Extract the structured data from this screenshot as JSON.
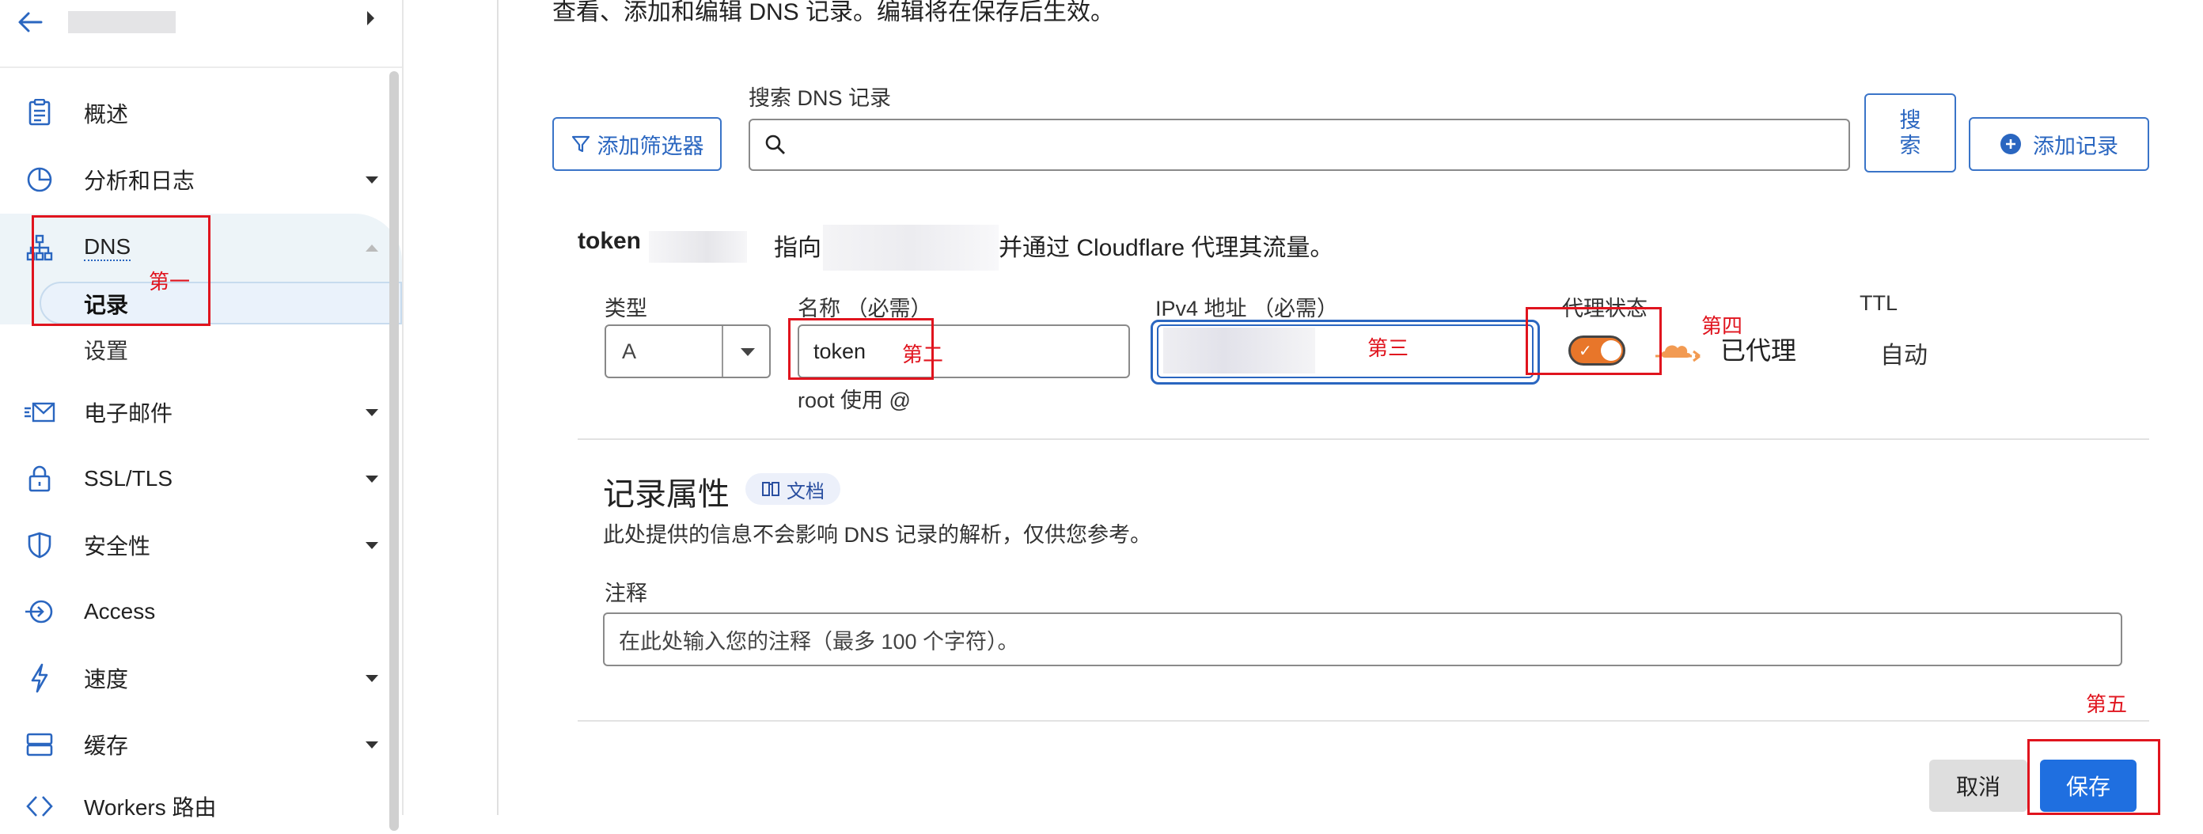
{
  "sidebar": {
    "back_icon": "arrow-left-icon",
    "account_caret_icon": "caret-right-icon",
    "items": [
      {
        "label": "概述",
        "icon": "document-icon"
      },
      {
        "label": "分析和日志",
        "icon": "pie-chart-icon"
      },
      {
        "label": "DNS",
        "icon": "network-icon"
      },
      {
        "label": "电子邮件",
        "icon": "mail-icon"
      },
      {
        "label": "SSL/TLS",
        "icon": "lock-icon"
      },
      {
        "label": "安全性",
        "icon": "shield-icon"
      },
      {
        "label": "Access",
        "icon": "access-icon"
      },
      {
        "label": "速度",
        "icon": "bolt-icon"
      },
      {
        "label": "缓存",
        "icon": "storage-icon"
      },
      {
        "label": "Workers 路由",
        "icon": "code-icon"
      }
    ],
    "dns_sub": [
      {
        "label": "记录"
      },
      {
        "label": "设置"
      }
    ]
  },
  "main": {
    "description": "查看、添加和编辑 DNS 记录。编辑将在保存后生效。",
    "add_filter_label": "添加筛选器",
    "search_label": "搜索 DNS 记录",
    "search_button": "搜\n索",
    "add_record_label": "添加记录",
    "summary": {
      "name": "token",
      "points_to": "指向",
      "proxied_text": "并通过 Cloudflare 代理其流量。"
    },
    "form": {
      "type_label": "类型",
      "type_value": "A",
      "name_label": "名称 （必需）",
      "name_value": "token",
      "name_hint": "root 使用 @",
      "ipv4_label": "IPv4 地址 （必需）",
      "proxy_label": "代理状态",
      "proxy_status": "已代理",
      "ttl_label": "TTL",
      "ttl_value": "自动"
    },
    "record_props": {
      "title": "记录属性",
      "docs_label": "文档",
      "desc": "此处提供的信息不会影响 DNS 记录的解析，仅供您参考。",
      "comment_label": "注释",
      "comment_placeholder": "在此处输入您的注释（最多 100 个字符）。"
    },
    "cancel_label": "取消",
    "save_label": "保存"
  },
  "annotations": {
    "first": "第一",
    "second": "第二",
    "third": "第三",
    "fourth": "第四",
    "fifth": "第五"
  },
  "colors": {
    "accent": "#2a66c0",
    "primary_button": "#1f6fe0",
    "proxy_orange": "#e8762a",
    "annotation_red": "#e0141e"
  }
}
